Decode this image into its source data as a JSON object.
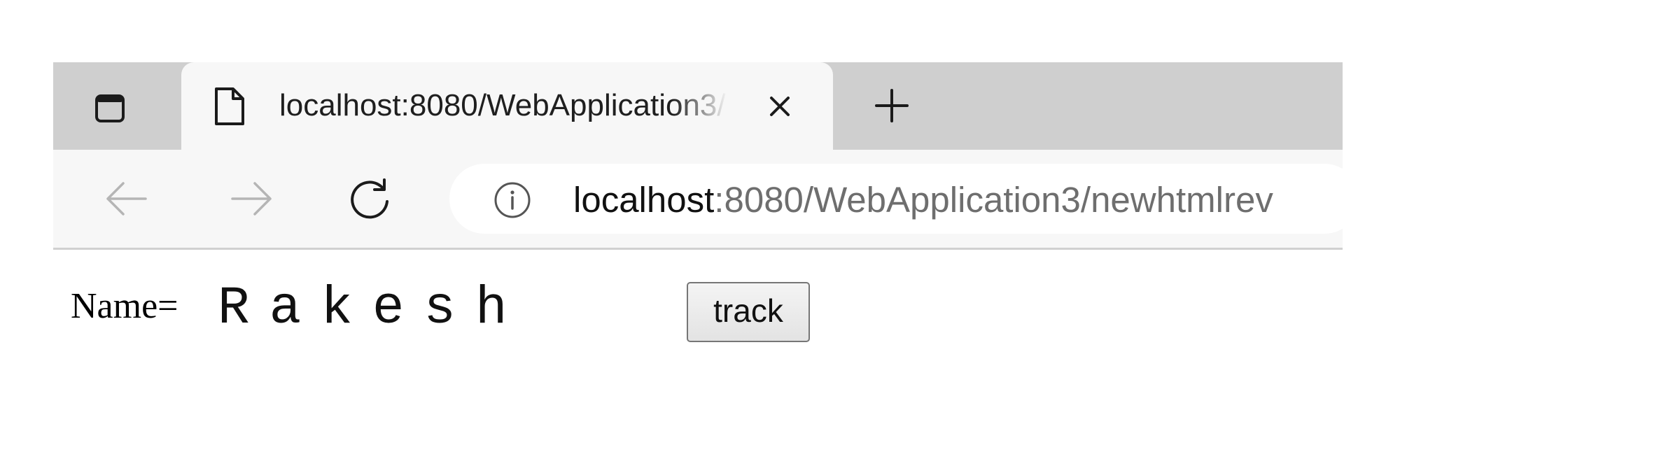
{
  "browser": {
    "tab": {
      "title": "localhost:8080/WebApplication3/"
    },
    "address_bar": {
      "host": "localhost",
      "rest": ":8080/WebApplication3/newhtmlrev"
    },
    "icons": {
      "tab_actions": "tab-actions-icon",
      "page": "page-icon",
      "close": "close-icon",
      "new_tab": "plus-icon",
      "back": "back-arrow-icon",
      "forward": "forward-arrow-icon",
      "refresh": "refresh-icon",
      "site_info": "info-icon"
    }
  },
  "form": {
    "label": "Name=",
    "value": "Rakesh",
    "button_label": "track"
  }
}
